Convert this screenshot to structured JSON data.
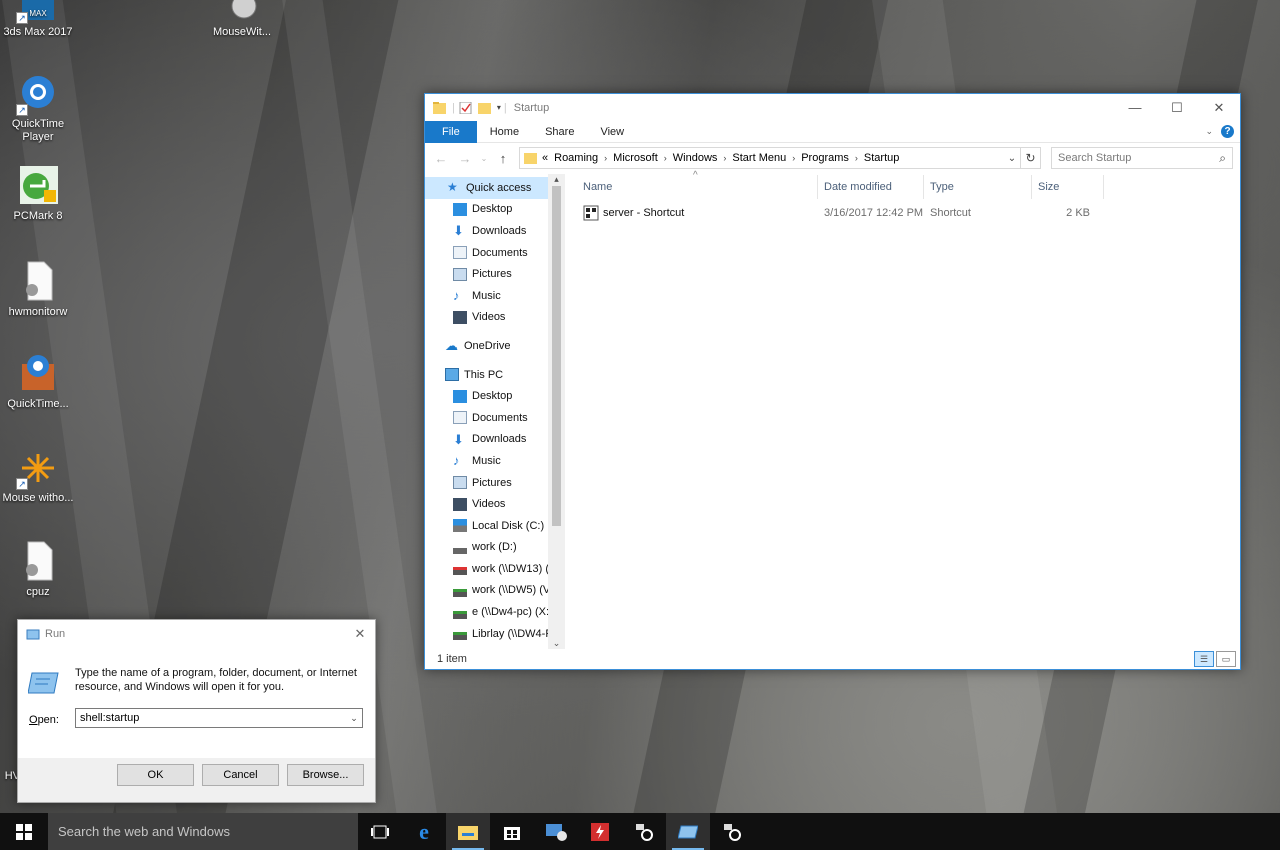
{
  "desktop": {
    "icons": [
      {
        "label": "3ds Max 2017",
        "icon": "3dsmax-icon"
      },
      {
        "label": "MouseWit...",
        "icon": "mouse-without-borders-icon"
      },
      {
        "label": "QuickTime Player",
        "icon": "quicktime-icon"
      },
      {
        "label": "PCMark 8",
        "icon": "pcmark-icon"
      },
      {
        "label": "hwmonitorw",
        "icon": "file-icon"
      },
      {
        "label": "QuickTime...",
        "icon": "quicktime-installer-icon"
      },
      {
        "label": "Mouse witho...",
        "icon": "mouse-without-borders-icon"
      },
      {
        "label": "cpuz",
        "icon": "file-icon"
      },
      {
        "label": "HV",
        "icon": "app-icon"
      }
    ]
  },
  "explorer": {
    "title": "Startup",
    "tabs": [
      "File",
      "Home",
      "Share",
      "View"
    ],
    "address": {
      "overflow": "«",
      "crumbs": [
        "Roaming",
        "Microsoft",
        "Windows",
        "Start Menu",
        "Programs",
        "Startup"
      ]
    },
    "search_placeholder": "Search Startup",
    "nav": {
      "quick_access": "Quick access",
      "quick_items": [
        "Desktop",
        "Downloads",
        "Documents",
        "Pictures",
        "Music",
        "Videos"
      ],
      "onedrive": "OneDrive",
      "this_pc": "This PC",
      "pc_items": [
        "Desktop",
        "Documents",
        "Downloads",
        "Music",
        "Pictures",
        "Videos",
        "Local Disk (C:)",
        "work (D:)",
        "work (\\\\DW13) (",
        "work (\\\\DW5) (V",
        "e (\\\\Dw4-pc) (X:",
        "Librlay (\\\\DW4-F"
      ]
    },
    "columns": [
      "Name",
      "Date modified",
      "Type",
      "Size"
    ],
    "files": [
      {
        "name": "server - Shortcut",
        "date": "3/16/2017 12:42 PM",
        "type": "Shortcut",
        "size": "2 KB"
      }
    ],
    "status": "1 item"
  },
  "run": {
    "title": "Run",
    "description": "Type the name of a program, folder, document, or Internet resource, and Windows will open it for you.",
    "open_label_access": "O",
    "open_label_rest": "pen:",
    "value": "shell:startup",
    "ok": "OK",
    "cancel": "Cancel",
    "browse": "Browse..."
  },
  "taskbar": {
    "search_placeholder": "Search the web and Windows"
  },
  "colors": {
    "accent": "#1979ca",
    "selection": "#cce8ff"
  }
}
